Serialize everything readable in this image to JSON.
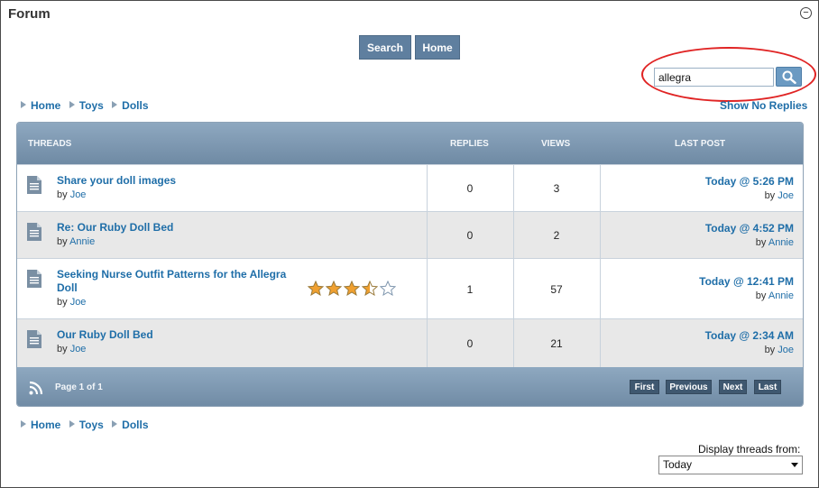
{
  "window": {
    "title": "Forum"
  },
  "toolbar": {
    "search_label": "Search",
    "home_label": "Home"
  },
  "search": {
    "value": "allegra",
    "button_icon": "magnifier-icon"
  },
  "breadcrumb": {
    "items": [
      "Home",
      "Toys",
      "Dolls"
    ]
  },
  "links": {
    "show_no_replies": "Show No Replies"
  },
  "table": {
    "headers": {
      "threads": "THREADS",
      "replies": "REPLIES",
      "views": "VIEWS",
      "last_post": "LAST POST"
    },
    "rows": [
      {
        "title": "Share your doll images",
        "by_prefix": "by",
        "author": "Joe",
        "replies": "0",
        "views": "3",
        "last_post_date": "Today @ 5:26 PM",
        "last_post_by": "Joe"
      },
      {
        "title": "Re: Our Ruby Doll Bed",
        "by_prefix": "by",
        "author": "Annie",
        "replies": "0",
        "views": "2",
        "last_post_date": "Today @ 4:52 PM",
        "last_post_by": "Annie"
      },
      {
        "title": "Seeking Nurse Outfit Patterns for the Allegra Doll",
        "by_prefix": "by",
        "author": "Joe",
        "replies": "1",
        "views": "57",
        "last_post_date": "Today @ 12:41 PM",
        "last_post_by": "Annie",
        "rating": 3.5,
        "rating_max": 5
      },
      {
        "title": "Our Ruby Doll Bed",
        "by_prefix": "by",
        "author": "Joe",
        "replies": "0",
        "views": "21",
        "last_post_date": "Today @ 2:34 AM",
        "last_post_by": "Joe"
      }
    ],
    "footer": {
      "page_info": "Page 1 of 1",
      "first": "First",
      "previous": "Previous",
      "next": "Next",
      "last": "Last"
    }
  },
  "display_threads": {
    "label": "Display threads from:",
    "selected": "Today"
  },
  "colors": {
    "accent": "#1f6ea8",
    "header_bg": "#7d98b2",
    "star": "#f0a030",
    "highlight_ring": "#e02424"
  }
}
